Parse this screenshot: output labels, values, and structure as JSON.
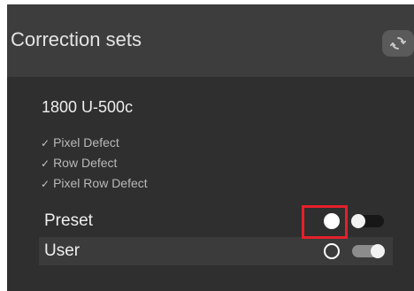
{
  "panel": {
    "title": "Correction sets",
    "refresh_icon": "refresh-icon"
  },
  "device": {
    "name": "1800 U-500c"
  },
  "defects": {
    "check_icon": "✓",
    "items": [
      {
        "label": "Pixel Defect"
      },
      {
        "label": "Row Defect"
      },
      {
        "label": "Pixel Row Defect"
      }
    ]
  },
  "options": [
    {
      "label": "Preset",
      "radio_selected": true,
      "toggle_on": false
    },
    {
      "label": "User",
      "radio_selected": false,
      "toggle_on": true
    }
  ],
  "colors": {
    "header_bg": "#3d3d3d",
    "panel_bg": "#2f2f2f",
    "highlight": "#e5202a"
  }
}
